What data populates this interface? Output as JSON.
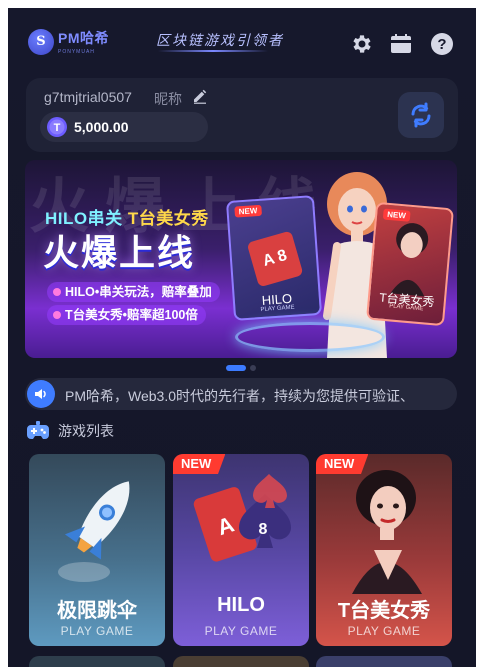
{
  "header": {
    "logo_badge": "S",
    "logo_name": "PM哈希",
    "logo_sub": "PONYMUAH",
    "slogan": "区块链游戏引领者",
    "icons": [
      "gear-icon",
      "wallet-icon",
      "help-icon"
    ]
  },
  "account": {
    "username": "g7tmjtrial0507",
    "nickname_label": "昵称",
    "balance": "5,000.00",
    "coin_symbol": "T"
  },
  "banner": {
    "bg_text": "火爆上线",
    "subtitle_a": "HILO串关 ",
    "subtitle_b": "T台美女秀",
    "title": "火爆上线",
    "bullets": [
      "HILO•串关玩法，赔率叠加",
      "T台美女秀•赔率超100倍"
    ],
    "card1": {
      "tag": "NEW",
      "name": "HILO",
      "sub": "PLAY GAME",
      "suit": "A 8"
    },
    "card2": {
      "tag": "NEW",
      "name": "T台美女秀",
      "sub": "PLAY GAME"
    },
    "slides": 2,
    "active_slide": 1
  },
  "notice": {
    "text": "PM哈希，Web3.0时代的先行者，持续为您提供可验证、"
  },
  "section": {
    "title": "游戏列表"
  },
  "games": [
    {
      "name": "极限跳伞",
      "sub": "PLAY GAME",
      "badge": ""
    },
    {
      "name": "HILO",
      "sub": "PLAY GAME",
      "badge": "NEW"
    },
    {
      "name": "T台美女秀",
      "sub": "PLAY GAME",
      "badge": "NEW"
    }
  ],
  "colors": {
    "background": "#16182c",
    "card": "#1f2236",
    "accent": "#3f7cff",
    "new_badge": "#ff3b30"
  }
}
